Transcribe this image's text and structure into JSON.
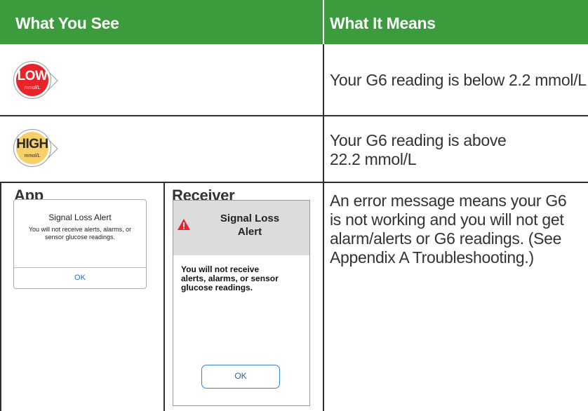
{
  "header": {
    "col1": "What You See",
    "col2": "What It Means"
  },
  "colors": {
    "header_green": "#3c9b3c",
    "low_red": "#e8232a",
    "high_yellow": "#f8d06a",
    "link_blue": "#2a6fc9"
  },
  "rows": {
    "low": {
      "icon": "low-glucose-gauge-icon",
      "value": "LOW",
      "unit": "mmol/L",
      "meaning": "Your G6 reading is below 2.2 mmol/L"
    },
    "high": {
      "icon": "high-glucose-gauge-icon",
      "value": "HIGH",
      "unit": "mmol/L",
      "meaning_line1": "Your G6 reading is above",
      "meaning_line2": "22.2 mmol/L"
    },
    "error": {
      "app_title": "App",
      "receiver_title": "Receiver",
      "meaning_lines": [
        "An error message means your G6",
        "is not working and you will not get",
        "alarm/alerts or G6 readings. (See",
        "Appendix A Troubleshooting.)"
      ],
      "app_dialog": {
        "title": "Signal Loss Alert",
        "message_line1": "You will not receive alerts, alarms, or",
        "message_line2": "sensor glucose readings.",
        "ok": "OK"
      },
      "receiver_dialog": {
        "title_line1": "Signal Loss",
        "title_line2": "Alert",
        "message_lines": [
          "You will not receive",
          "alerts, alarms, or sensor",
          "glucose readings."
        ],
        "ok": "OK",
        "icon": "warning-triangle-icon"
      }
    }
  }
}
